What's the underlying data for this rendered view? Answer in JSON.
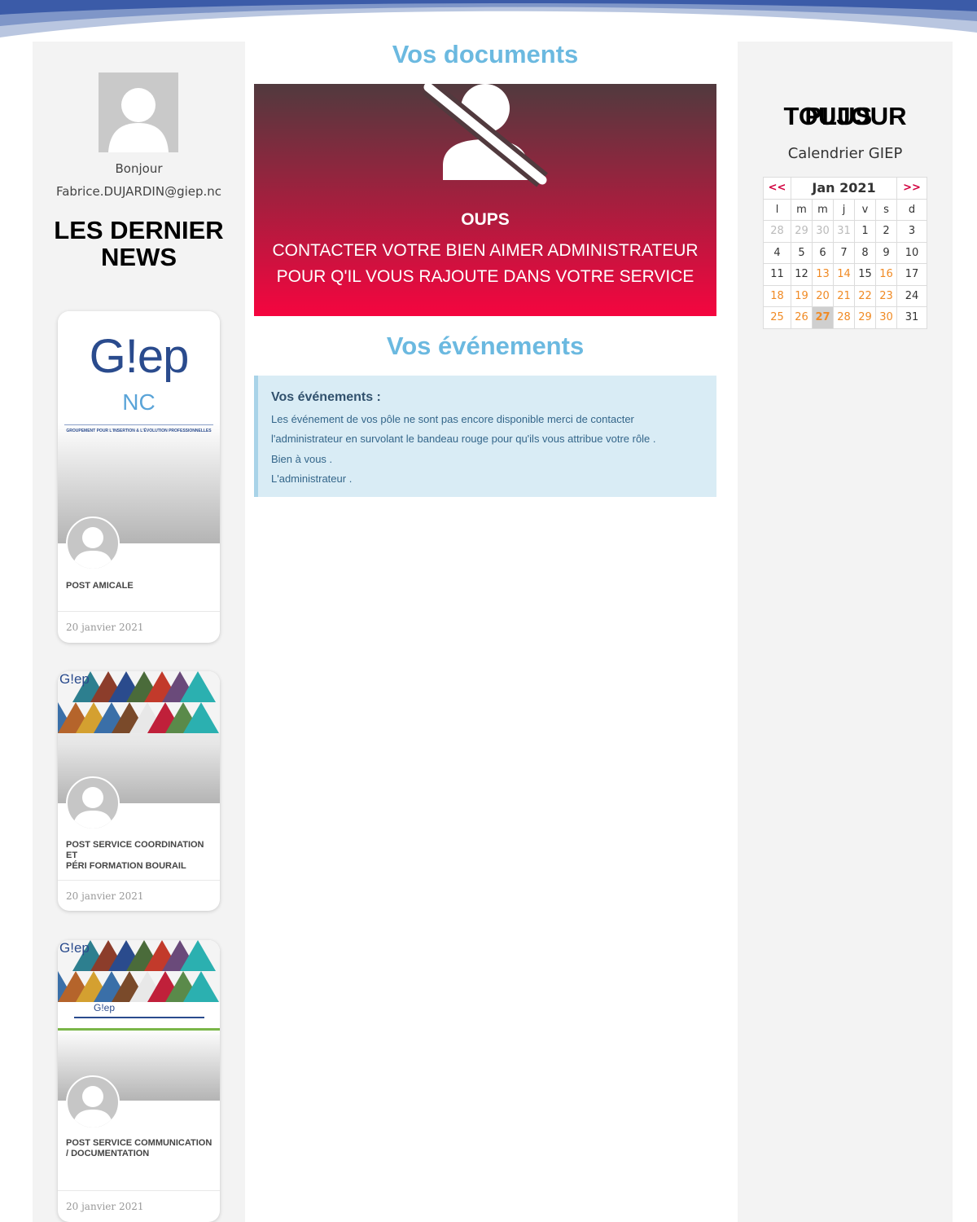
{
  "user": {
    "greeting": "Bonjour",
    "email": "Fabrice.DUJARDIN@giep.nc"
  },
  "news": {
    "heading_line1": "LES DERNIER",
    "heading_line2": "NEWS",
    "posts": [
      {
        "title": "POST AMICALE",
        "date": "20 janvier 2021",
        "image_text": "G!ep",
        "image_sub": "NC",
        "image_caption": "GROUPEMENT POUR L'INSERTION & L'ÉVOLUTION PROFESSIONNELLES"
      },
      {
        "title_line1": "POST SERVICE COORDINATION ET",
        "title_line2": "PÉRI FORMATION BOURAIL",
        "date": "20 janvier 2021",
        "image_text": "G!ep"
      },
      {
        "title_line1": "POST SERVICE COMMUNICATION",
        "title_line2": "/ DOCUMENTATION",
        "date": "20 janvier 2021",
        "image_text": "G!ep",
        "image_text2": "G!ep"
      }
    ]
  },
  "documents": {
    "heading": "Vos documents",
    "banner_icon": "user-slash-icon",
    "banner_title": "OUPS",
    "banner_line1": "CONTACTER VOTRE BIEN AIMER ADMINISTRATEUR",
    "banner_line2": "POUR Q'IL VOUS RAJOUTE DANS VOTRE SERVICE"
  },
  "events": {
    "heading": "Vos événements",
    "alert_title": "Vos événements :",
    "alert_line1": "Les événement de vos pôle ne sont pas encore disponible merci de contacter",
    "alert_line2": "l'administrateur en survolant le bandeau rouge pour qu'ils vous attribue votre rôle .",
    "alert_line3": "Bien à vous .",
    "alert_line4": "L'administrateur ."
  },
  "calendar": {
    "logo_word1": "TOUJOUR",
    "logo_word2": "PLUS",
    "subtitle": "Calendrier GIEP",
    "prev_label": "<<",
    "next_label": ">>",
    "month_label": "Jan 2021",
    "weekdays": [
      "l",
      "m",
      "m",
      "j",
      "v",
      "s",
      "d"
    ],
    "weeks": [
      [
        "28",
        "29",
        "30",
        "31",
        "1",
        "2",
        "3"
      ],
      [
        "4",
        "5",
        "6",
        "7",
        "8",
        "9",
        "10"
      ],
      [
        "11",
        "12",
        "13",
        "14",
        "15",
        "16",
        "17"
      ],
      [
        "18",
        "19",
        "20",
        "21",
        "22",
        "23",
        "24"
      ],
      [
        "25",
        "26",
        "27",
        "28",
        "29",
        "30",
        "31"
      ]
    ],
    "today": "27",
    "colors": {
      "event": "#f08a24",
      "nav": "#d2003f",
      "other_month": "#bbbbbb"
    }
  },
  "colors": {
    "accent_blue": "#6bb9e0",
    "banner_top": "#513a3e",
    "banner_bottom": "#f5053f",
    "alert_bg": "#d9ecf5"
  }
}
